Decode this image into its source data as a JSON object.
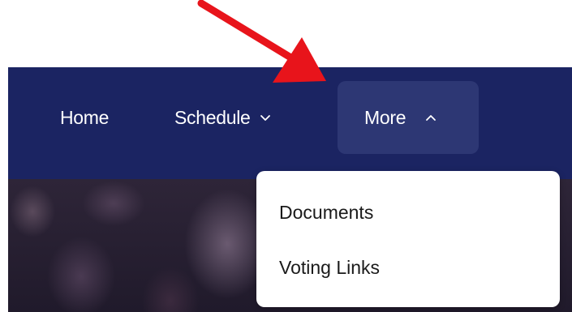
{
  "nav": {
    "items": [
      {
        "label": "Home",
        "has_dropdown": false,
        "expanded": false
      },
      {
        "label": "Schedule",
        "has_dropdown": true,
        "expanded": false
      },
      {
        "label": "More",
        "has_dropdown": true,
        "expanded": true
      }
    ],
    "bg_color": "#1b2462",
    "active_bg_color": "#2d3774"
  },
  "dropdown": {
    "items": [
      {
        "label": "Documents"
      },
      {
        "label": "Voting Links"
      }
    ]
  },
  "annotation": {
    "arrow_color": "#e8141b",
    "icon": "red-arrow-icon"
  },
  "icons": {
    "schedule_chevron": "chevron-down-icon",
    "more_chevron": "chevron-up-icon"
  }
}
